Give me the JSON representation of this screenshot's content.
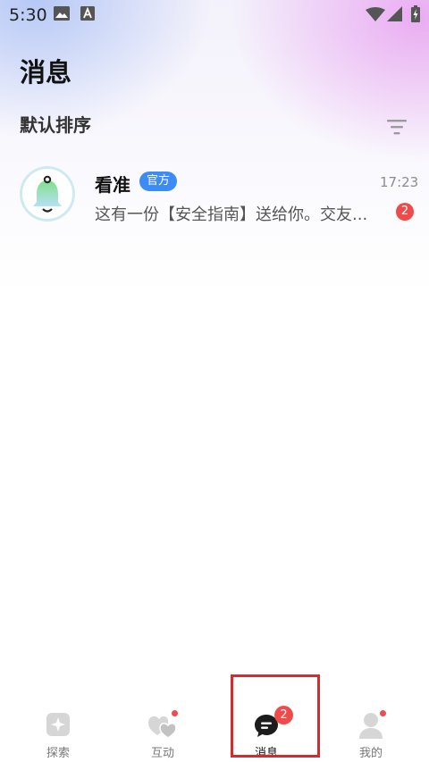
{
  "status_bar": {
    "time": "5:30",
    "icons": [
      "image-icon",
      "font-a-icon",
      "wifi-icon",
      "signal-icon",
      "battery-charging-icon"
    ]
  },
  "page": {
    "title": "消息",
    "sort_label": "默认排序",
    "filter_icon": "filter-icon"
  },
  "conversations": [
    {
      "name": "看准",
      "badge": "官方",
      "time": "17:23",
      "preview": "这有一份【安全指南】送给你。交友...",
      "unread": "2",
      "avatar_icon": "bell-icon"
    }
  ],
  "tabbar": {
    "tabs": [
      {
        "label": "探索",
        "icon": "explore-icon"
      },
      {
        "label": "互动",
        "icon": "hearts-icon"
      },
      {
        "label": "消息",
        "icon": "chat-bubble-icon",
        "badge": "2"
      },
      {
        "label": "我的",
        "icon": "profile-icon"
      }
    ]
  },
  "colors": {
    "accent_blue": "#3d8bf5",
    "badge_red": "#ef4b4b",
    "highlight_red": "#d62b2b"
  }
}
